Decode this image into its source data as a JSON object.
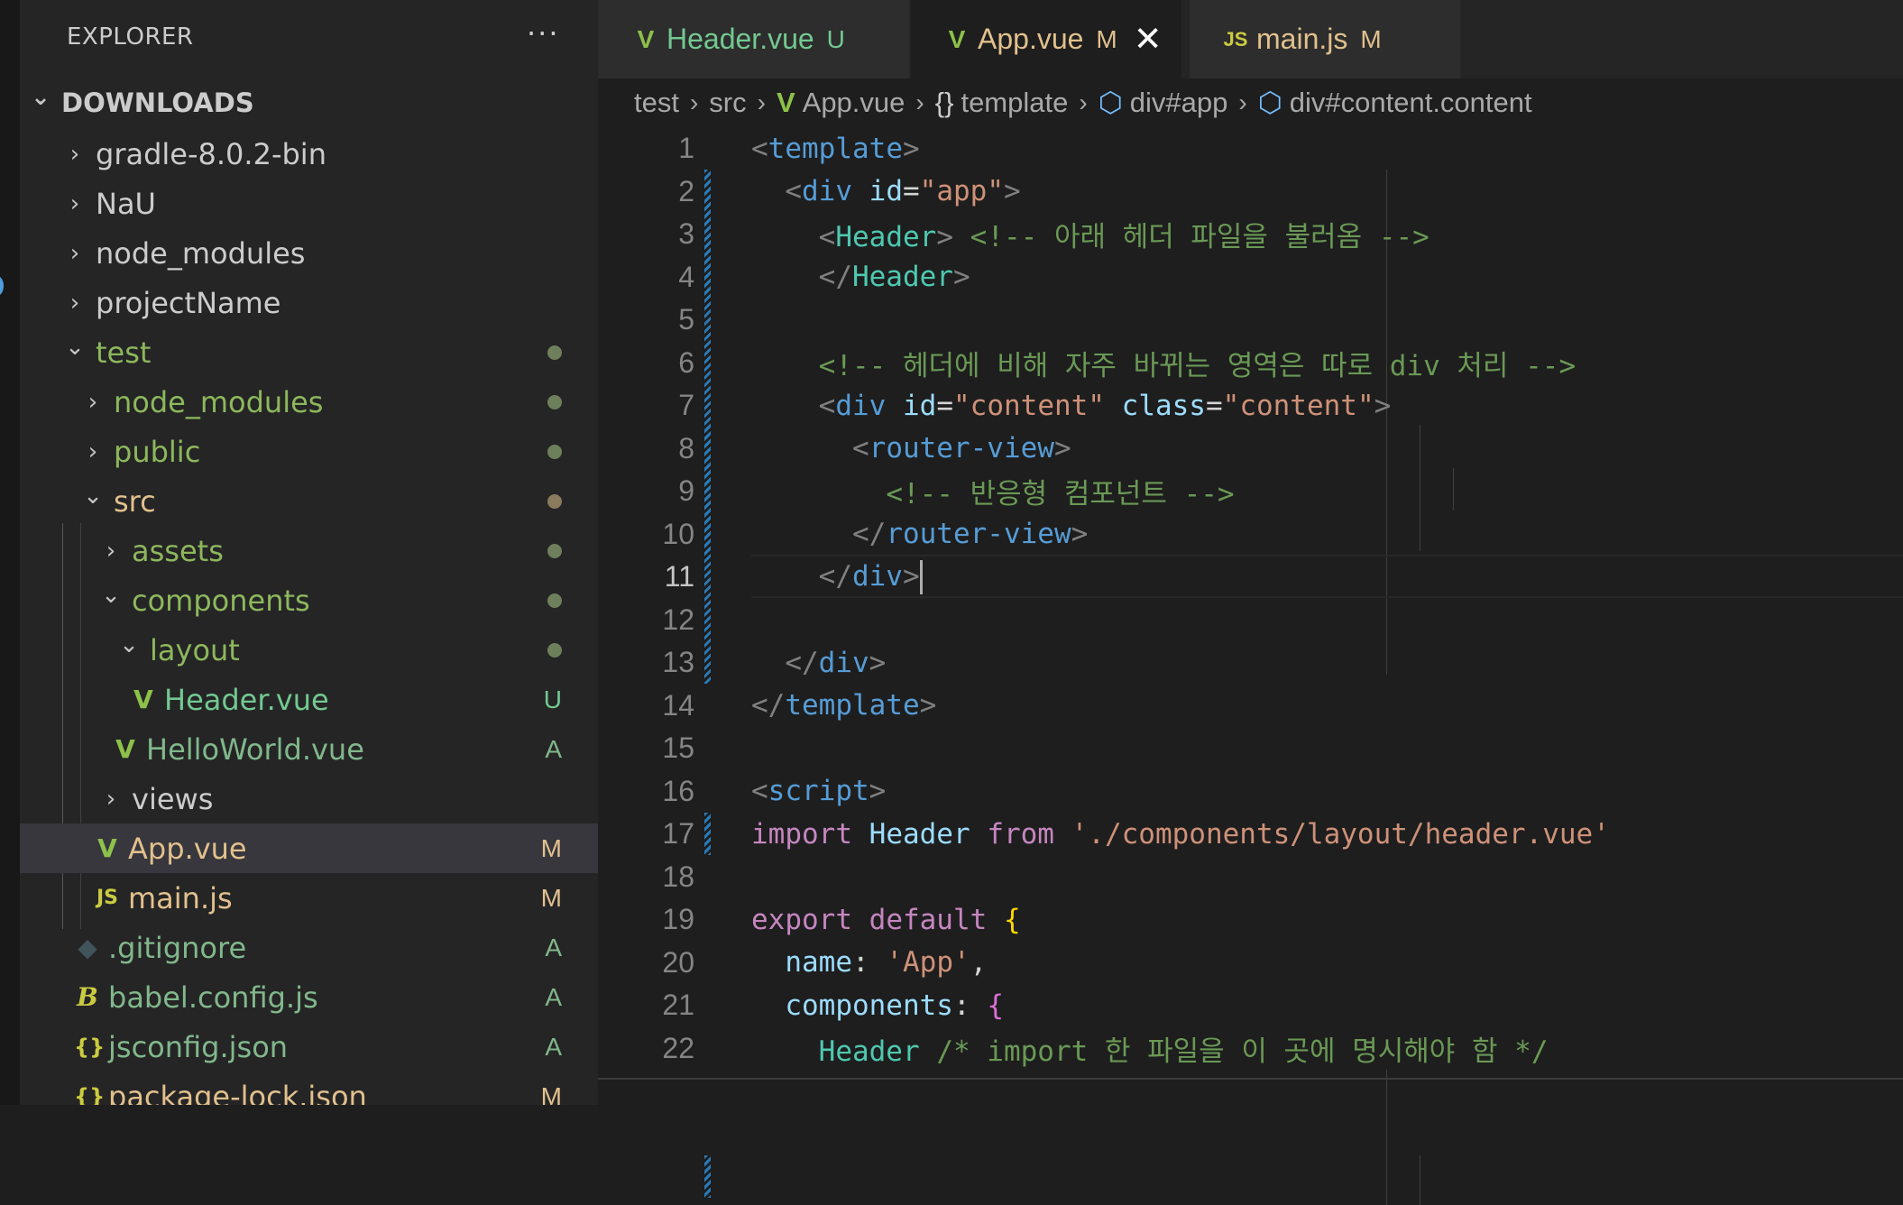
{
  "sidebar": {
    "title": "EXPLORER",
    "more_label": "···",
    "section": "DOWNLOADS",
    "items": [
      {
        "label": "gradle-8.0.2-bin",
        "badge": ""
      },
      {
        "label": "NaU",
        "badge": ""
      },
      {
        "label": "node_modules",
        "badge": ""
      },
      {
        "label": "projectName",
        "badge": ""
      },
      {
        "label": "test",
        "badge": ""
      },
      {
        "label": "node_modules",
        "badge": ""
      },
      {
        "label": "public",
        "badge": ""
      },
      {
        "label": "src",
        "badge": ""
      },
      {
        "label": "assets",
        "badge": ""
      },
      {
        "label": "components",
        "badge": ""
      },
      {
        "label": "layout",
        "badge": ""
      },
      {
        "label": "Header.vue",
        "badge": "U"
      },
      {
        "label": "HelloWorld.vue",
        "badge": "A"
      },
      {
        "label": "views",
        "badge": ""
      },
      {
        "label": "App.vue",
        "badge": "M"
      },
      {
        "label": "main.js",
        "badge": "M"
      },
      {
        "label": ".gitignore",
        "badge": "A"
      },
      {
        "label": "babel.config.js",
        "badge": "A"
      },
      {
        "label": "jsconfig.json",
        "badge": "A"
      },
      {
        "label": "package-lock.json",
        "badge": "M"
      }
    ],
    "icons": {
      "vue": "V",
      "js": "JS",
      "json": "{}",
      "babel": "B",
      "git": "◆",
      "chevron_right": "›",
      "chevron_down": "⌄"
    }
  },
  "tabs": [
    {
      "label": "Header.vue",
      "badge": "U"
    },
    {
      "label": "App.vue",
      "badge": "M",
      "close": "✕"
    },
    {
      "label": "main.js",
      "badge": "M"
    }
  ],
  "breadcrumb": [
    "test",
    "src",
    "App.vue",
    "template",
    "div#app",
    "div#content.content"
  ],
  "breadcrumb_icons": {
    "vue": "V",
    "braces": "{}",
    "cube": "⬡"
  },
  "editor": {
    "line_numbers": [
      "1",
      "2",
      "3",
      "4",
      "5",
      "6",
      "7",
      "8",
      "9",
      "10",
      "11",
      "12",
      "13",
      "14",
      "15",
      "16",
      "17",
      "18",
      "19",
      "20",
      "21",
      "22"
    ],
    "active_line": "11"
  },
  "colors": {
    "accent": "#007acc",
    "untracked": "#73c991",
    "modified": "#e2c08d",
    "added": "#81b88b",
    "vue_green": "#8dc149",
    "folder_text": "#8db85c"
  }
}
